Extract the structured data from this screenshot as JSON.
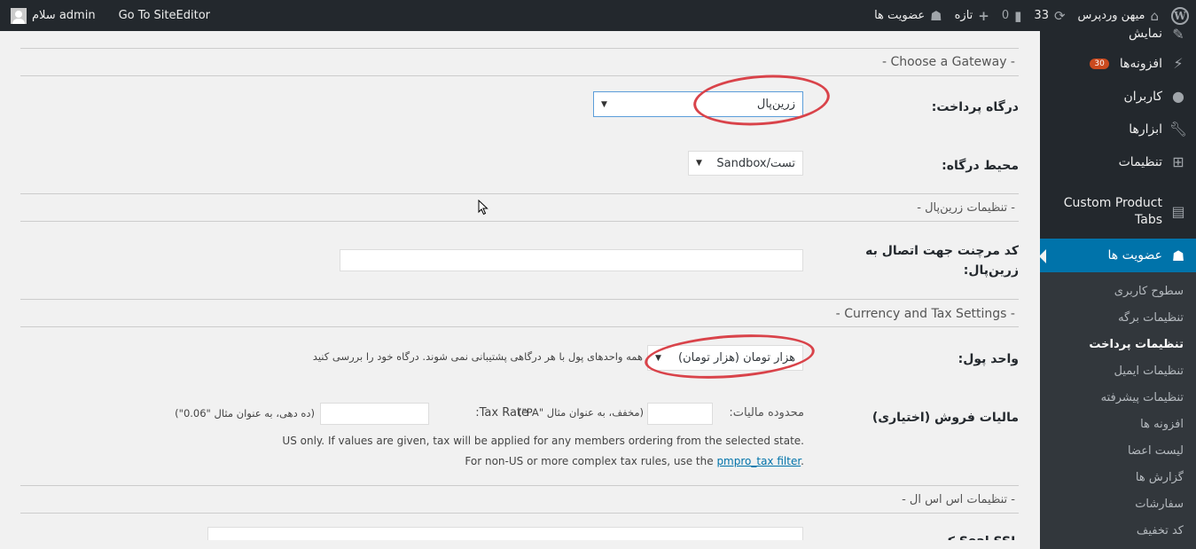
{
  "adminbar": {
    "greeting": "سلام admin",
    "siteeditor": "Go To SiteEditor",
    "site_name": "میهن وردپرس",
    "updates_count": "33",
    "comments_count": "0",
    "new_label": "تازه",
    "membership_label": "عضویت ها"
  },
  "sidebar": {
    "items": [
      {
        "label": "نمایش",
        "icon": "paintbrush-icon"
      },
      {
        "label": "افزونه‌ها",
        "icon": "plugin-icon",
        "badge": "30"
      },
      {
        "label": "کاربران",
        "icon": "users-icon"
      },
      {
        "label": "ابزارها",
        "icon": "wrench-icon"
      },
      {
        "label": "تنظیمات",
        "icon": "settings-icon"
      },
      {
        "label": "Custom Product Tabs",
        "icon": "tabs-icon"
      },
      {
        "label": "عضویت ها",
        "icon": "groups-icon",
        "active": true
      }
    ],
    "submenu": [
      "سطوح کاربری",
      "تنظیمات برگه",
      "تنظیمات پرداخت",
      "تنظیمات ایمیل",
      "تنظیمات پیشرفته",
      "افزونه ها",
      "لیست اعضا",
      "گزارش ها",
      "سفارشات",
      "کد تخفیف"
    ],
    "current_submenu": "تنظیمات پرداخت"
  },
  "form": {
    "section_gateway": "- Choose a Gateway -",
    "gateway_label": "درگاه پرداخت:",
    "gateway_value": "زرین‌پال",
    "environment_label": "محیط درگاه:",
    "environment_value": "Sandbox/تست",
    "section_zarinpal": "- تنظیمات زرین‌پال -",
    "merchant_label": "کد مرچنت جهت اتصال به زرین‌پال:",
    "merchant_value": "",
    "section_currency": "- Currency and Tax Settings -",
    "currency_label": "واحد پول:",
    "currency_value": "هزار تومان (هزار تومان)",
    "currency_note": "همه واحدهای پول با هر درگاهی پشتیبانی نمی شوند. درگاه خود را بررسی کنید",
    "tax_label": "مالیات فروش (اختیاری)",
    "tax_state_label": "محدوده مالیات:",
    "tax_state_hint": "(مخفف، به عنوان مثال \"PA\")",
    "tax_rate_label": "Tax Rate:",
    "tax_rate_hint": "(ده دهی، به عنوان مثال \"0.06\")",
    "tax_note1": "US only. If values are given, tax will be applied for any members ordering from the selected state.",
    "tax_note2_prefix": "For non-US or more complex tax rules, use the",
    "tax_note2_link": "pmpro_tax filter",
    "section_ssl": "- تنظیمات اس اس ال -",
    "ssl_label": "Seal SSL کد"
  }
}
